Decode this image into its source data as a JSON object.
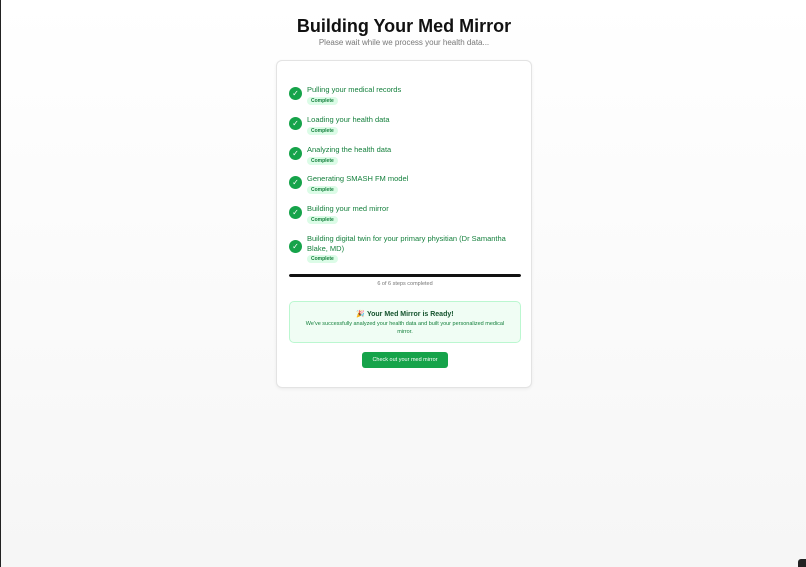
{
  "header": {
    "title": "Building Your Med Mirror",
    "subtitle": "Please wait while we process your health data..."
  },
  "steps": [
    {
      "label": "Pulling your medical records",
      "status": "Complete"
    },
    {
      "label": "Loading your health data",
      "status": "Complete"
    },
    {
      "label": "Analyzing the health data",
      "status": "Complete"
    },
    {
      "label": "Generating SMASH FM model",
      "status": "Complete"
    },
    {
      "label": "Building your med mirror",
      "status": "Complete"
    },
    {
      "label": "Building digital twin for your primary physitian (Dr Samantha Blake, MD)",
      "status": "Complete"
    }
  ],
  "progress": {
    "completed": 6,
    "total": 6,
    "fraction": 1.0,
    "text": "6 of 6 steps completed"
  },
  "ready": {
    "emoji": "🎉",
    "title": "Your Med Mirror is Ready!",
    "message": "We've successfully analyzed your health data and built your personalized medical mirror."
  },
  "cta": {
    "label": "Check out your med mirror"
  },
  "colors": {
    "accent": "#16a34a",
    "accent_text": "#15803d",
    "badge_bg": "#dcfce7",
    "ready_bg": "#f0fdf4"
  },
  "icons": {
    "step_icon": "check-circle-icon"
  }
}
